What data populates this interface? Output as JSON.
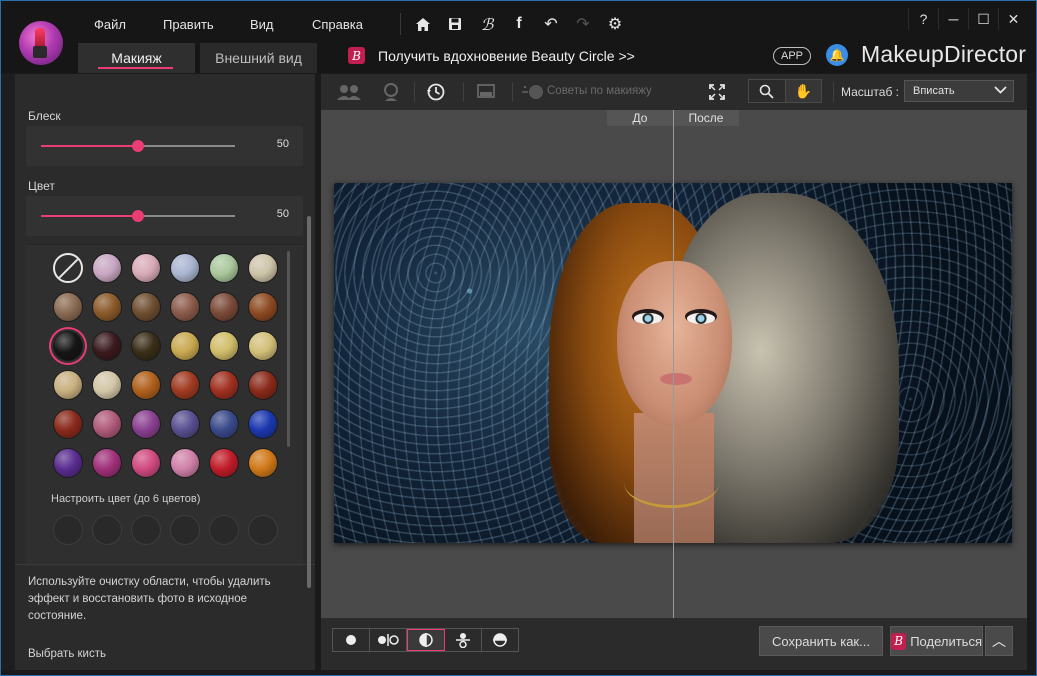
{
  "menu": {
    "file": "Файл",
    "edit": "Править",
    "view": "Вид",
    "help": "Справка"
  },
  "window_controls": {
    "help": "?",
    "minimize": "─",
    "maximize": "☐",
    "close": "✕"
  },
  "tabs": [
    {
      "label": "Макияж",
      "active": true
    },
    {
      "label": "Внешний вид",
      "active": false
    }
  ],
  "promo": {
    "badge": "B",
    "text": "Получить вдохновение Beauty Circle >>"
  },
  "app_pill": "APP",
  "brand": {
    "bold": "Makeup",
    "rest": "Director"
  },
  "left_panel": {
    "shine_label": "Блеск",
    "shine_value": "50",
    "shine_level": 0.5,
    "color_label": "Цвет",
    "color_value": "50",
    "color_level": 0.5,
    "custom_label": "Настроить цвет (до 6 цветов)",
    "tip": "Используйте очистку области, чтобы удалить эффект и восстановить фото в исходное состояние.",
    "brush_label": "Выбрать кисть",
    "swatches": [
      [
        "none",
        "#c8a6c2",
        "#d8aab8",
        "#a9b4d0",
        "#a9c79c",
        "#cdc3a8"
      ],
      [
        "#8a6a52",
        "#8a5a2a",
        "#6e4e30",
        "#8a5a4a",
        "#7a4a38",
        "#8c4a22"
      ],
      [
        "#161616",
        "#3a1a1e",
        "#3a2e18",
        "#c9a850",
        "#d0bd6a",
        "#d2bf78"
      ],
      [
        "#c8b080",
        "#d2c6a6",
        "#b0601c",
        "#a03a20",
        "#a03020",
        "#8a2a1a"
      ],
      [
        "#8a2a1c",
        "#b05a7a",
        "#8a4090",
        "#585090",
        "#3a4a8a",
        "#1c38b0"
      ],
      [
        "#5a2c90",
        "#a0307a",
        "#d04a80",
        "#d080a8",
        "#c01c28",
        "#d07818"
      ]
    ],
    "selected_swatch": "2-0"
  },
  "work_toolbar": {
    "tips": "Советы по макияжу",
    "scale_label": "Масштаб :",
    "scale_value": "Вписать"
  },
  "canvas": {
    "before": "До",
    "after": "После"
  },
  "bottom": {
    "save": "Сохранить как...",
    "share": "Поделиться",
    "share_badge": "B",
    "up": "︿"
  },
  "colors": {
    "accent": "#ea3d74",
    "panel": "#2b2b2b",
    "canvas": "#4a4a4a"
  }
}
